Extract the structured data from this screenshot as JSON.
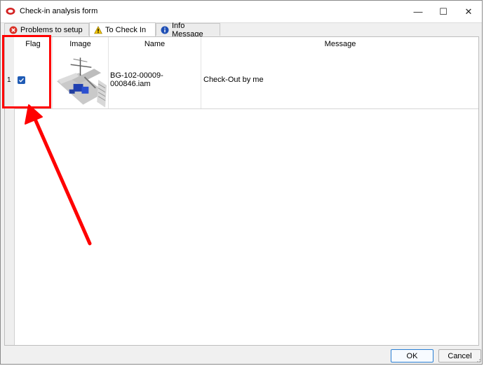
{
  "window": {
    "title": "Check-in analysis form",
    "minimize_glyph": "—",
    "maximize_glyph": "☐",
    "close_glyph": "✕"
  },
  "tabs": [
    {
      "label": "Problems to setup",
      "icon": "error-circle-icon",
      "color": "#d93025"
    },
    {
      "label": "To Check In",
      "icon": "warning-triangle-icon",
      "color": "#f2c500"
    },
    {
      "label": "Info Message",
      "icon": "info-circle-icon",
      "color": "#1f4fb5"
    }
  ],
  "table": {
    "columns": [
      "Flag",
      "Image",
      "Name",
      "Message"
    ],
    "rows": [
      {
        "row_number": "1",
        "flag_checked": true,
        "image": "assembly-thumbnail",
        "name": "BG-102-00009-000846.iam",
        "message": "Check-Out by me"
      }
    ]
  },
  "buttons": {
    "ok": "OK",
    "cancel": "Cancel"
  },
  "annotation": {
    "highlight_color": "#ff0000",
    "highlight_target": "Flag"
  }
}
